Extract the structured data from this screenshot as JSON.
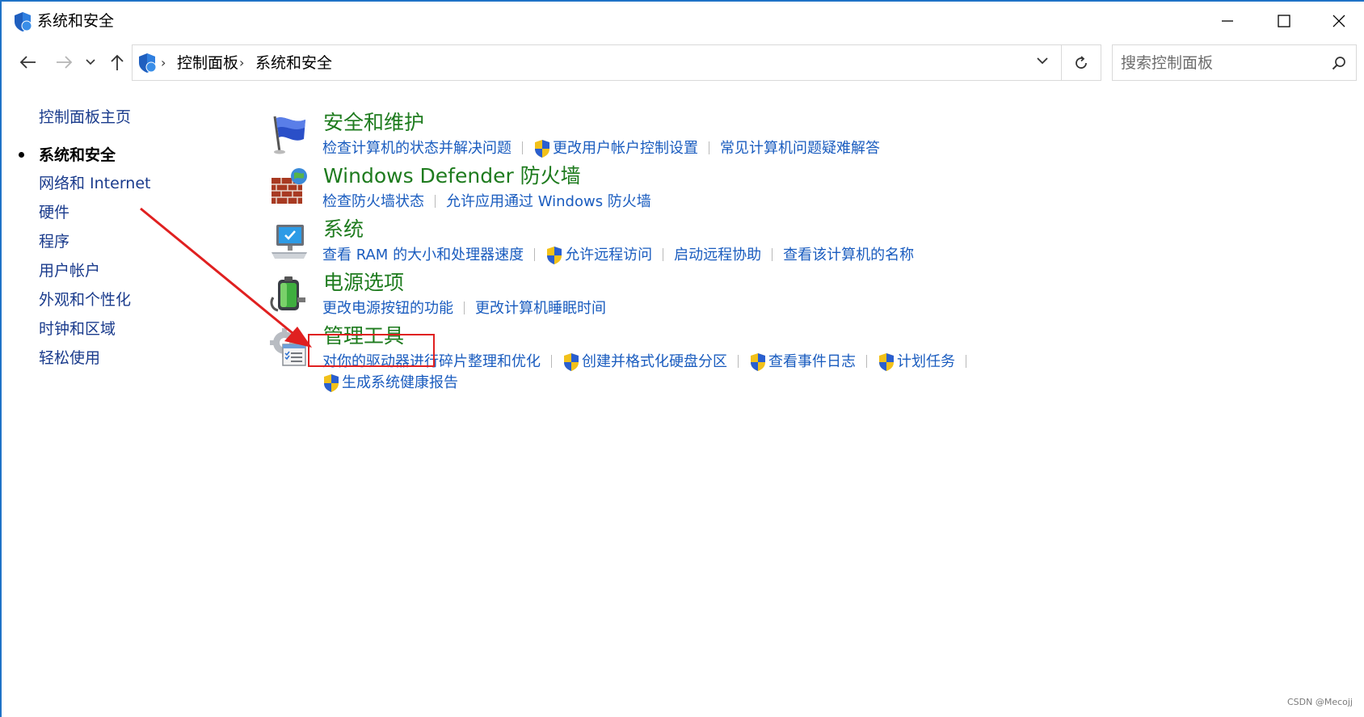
{
  "window": {
    "title": "系统和安全"
  },
  "nav": {
    "address_crumbs": [
      "控制面板",
      "系统和安全"
    ],
    "search_placeholder": "搜索控制面板"
  },
  "sidebar": {
    "home": "控制面板主页",
    "items": [
      {
        "label": "系统和安全",
        "active": true
      },
      {
        "label": "网络和 Internet"
      },
      {
        "label": "硬件"
      },
      {
        "label": "程序"
      },
      {
        "label": "用户帐户"
      },
      {
        "label": "外观和个性化"
      },
      {
        "label": "时钟和区域"
      },
      {
        "label": "轻松使用"
      }
    ]
  },
  "categories": [
    {
      "title": "安全和维护",
      "icon": "flag-icon",
      "links": [
        {
          "label": "检查计算机的状态并解决问题",
          "shield": false
        },
        {
          "label": "更改用户帐户控制设置",
          "shield": true
        },
        {
          "label": "常见计算机问题疑难解答",
          "shield": false
        }
      ]
    },
    {
      "title": "Windows Defender 防火墙",
      "icon": "firewall-icon",
      "links": [
        {
          "label": "检查防火墙状态",
          "shield": false
        },
        {
          "label": "允许应用通过 Windows 防火墙",
          "shield": false
        }
      ]
    },
    {
      "title": "系统",
      "icon": "computer-icon",
      "links": [
        {
          "label": "查看 RAM 的大小和处理器速度",
          "shield": false
        },
        {
          "label": "允许远程访问",
          "shield": true
        },
        {
          "label": "启动远程协助",
          "shield": false
        },
        {
          "label": "查看该计算机的名称",
          "shield": false
        }
      ]
    },
    {
      "title": "电源选项",
      "icon": "battery-icon",
      "links": [
        {
          "label": "更改电源按钮的功能",
          "shield": false
        },
        {
          "label": "更改计算机睡眠时间",
          "shield": false
        }
      ]
    },
    {
      "title": "管理工具",
      "icon": "admin-tools-icon",
      "links": [
        {
          "label": "对你的驱动器进行碎片整理和优化",
          "shield": false
        },
        {
          "label": "创建并格式化硬盘分区",
          "shield": true
        },
        {
          "label": "查看事件日志",
          "shield": true
        },
        {
          "label": "计划任务",
          "shield": true
        }
      ],
      "links_row2": [
        {
          "label": "生成系统健康报告",
          "shield": true
        }
      ]
    }
  ],
  "watermark": "CSDN @Mecojj",
  "colors": {
    "window_border": "#1f73c7",
    "category_title": "#1e7b1e",
    "link": "#1a5cbf",
    "annotation": "#e02020"
  }
}
